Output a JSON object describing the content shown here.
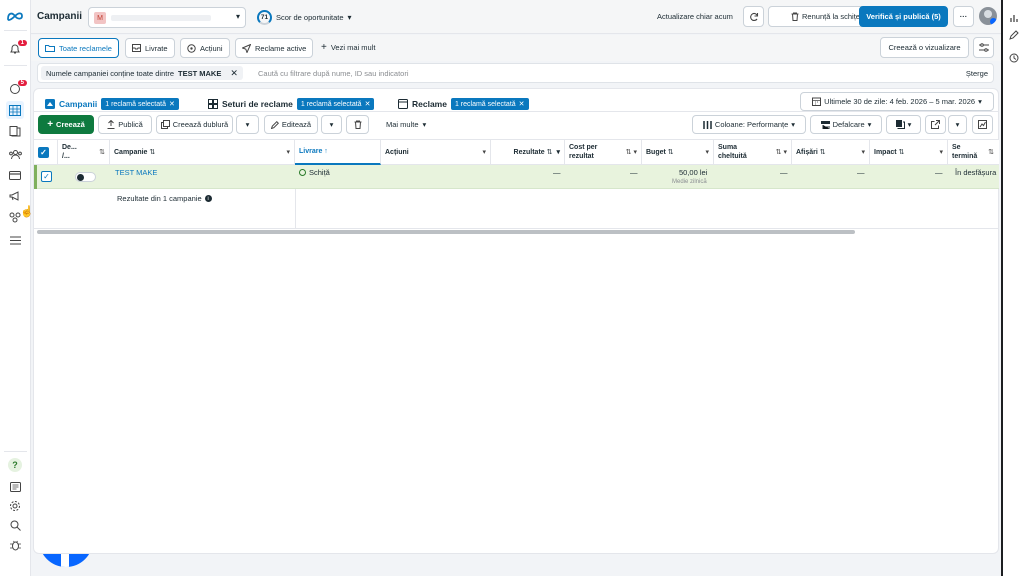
{
  "header": {
    "title": "Campanii",
    "account_initial": "M",
    "score_value": "71",
    "score_label": "Scor de oportunitate",
    "status_text": "Actualizare chiar acum",
    "discard_label": "Renunță la schițe",
    "publish_label": "Verifică și publică (5)",
    "more_label": "···"
  },
  "tabs": {
    "all": "Toate reclamele",
    "delivered": "Livrate",
    "actions": "Acțiuni",
    "active": "Reclame active",
    "more": "Vezi mai mult",
    "create_view": "Creează o vizualizare"
  },
  "filter": {
    "chip_label": "Numele campaniei conține toate dintre",
    "chip_value": "TEST MAKE",
    "placeholder": "Caută cu filtrare după nume, ID sau indicatori",
    "clear": "Șterge"
  },
  "levels": {
    "campaigns": "Campanii",
    "adsets": "Seturi de reclame",
    "ads": "Reclame",
    "badge": "1 reclamă selectată",
    "date_range": "Ultimele 30 de zile: 4 feb. 2026 – 5 mar. 2026"
  },
  "toolbar": {
    "create": "Creează",
    "publish": "Publică",
    "duplicate": "Creează dublură",
    "edit": "Editează",
    "more": "Mai multe",
    "columns": "Coloane: Performanțe",
    "breakdown": "Defalcare"
  },
  "table": {
    "headers": {
      "toggle": "De... /...",
      "campaign": "Campanie",
      "delivery": "Livrare",
      "actions": "Acțiuni",
      "results": "Rezultate",
      "cost": "Cost per rezultat",
      "budget": "Buget",
      "spent": "Suma cheltuită",
      "impressions": "Afișări",
      "impact": "Impact",
      "ends": "Se termină"
    },
    "row": {
      "name": "TEST MAKE",
      "delivery": "Schiță",
      "results": "—",
      "cost": "—",
      "budget": "50,00 lei",
      "budget_type": "Medie zilnică",
      "spent": "—",
      "impressions": "—",
      "impact": "—",
      "ends": "În desfășura"
    },
    "footer": "Rezultate din 1 campanie"
  },
  "sidebar": {
    "notif_count": "1",
    "alerts_count": "5"
  },
  "colors": {
    "accent": "#0a78be",
    "primary_green": "#0e7a3f",
    "row_highlight": "#e8f3dd",
    "alert_red": "#e41e3f"
  }
}
